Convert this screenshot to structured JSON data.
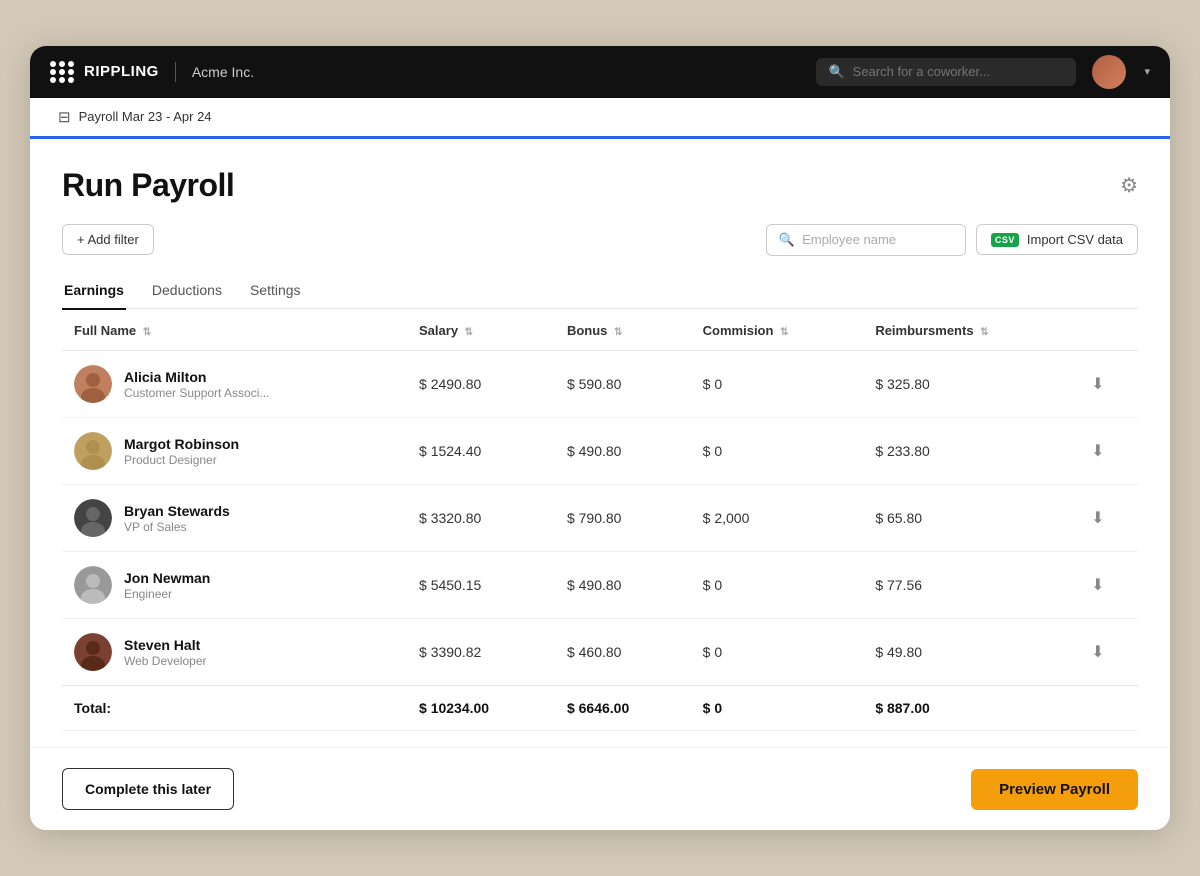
{
  "nav": {
    "logo_text": "RIPPLING",
    "company": "Acme Inc.",
    "search_placeholder": "Search for a coworker...",
    "chevron": "▾"
  },
  "breadcrumb": {
    "text": "Payroll Mar 23 - Apr 24"
  },
  "page": {
    "title": "Run Payroll"
  },
  "toolbar": {
    "add_filter": "+ Add filter",
    "employee_placeholder": "Employee name",
    "csv_badge": "CSV",
    "import_csv": "Import CSV data"
  },
  "tabs": [
    {
      "id": "earnings",
      "label": "Earnings",
      "active": true
    },
    {
      "id": "deductions",
      "label": "Deductions",
      "active": false
    },
    {
      "id": "settings",
      "label": "Settings",
      "active": false
    }
  ],
  "table": {
    "columns": [
      {
        "id": "name",
        "label": "Full Name"
      },
      {
        "id": "salary",
        "label": "Salary"
      },
      {
        "id": "bonus",
        "label": "Bonus"
      },
      {
        "id": "commission",
        "label": "Commision"
      },
      {
        "id": "reimbursements",
        "label": "Reimbursments"
      }
    ],
    "rows": [
      {
        "id": "alicia",
        "name": "Alicia Milton",
        "role": "Customer Support Associ...",
        "salary": "$ 2490.80",
        "bonus": "$ 590.80",
        "commission": "$ 0",
        "reimbursements": "$ 325.80",
        "avatar_color1": "#b07050",
        "avatar_color2": "#c89070"
      },
      {
        "id": "margot",
        "name": "Margot Robinson",
        "role": "Product Designer",
        "salary": "$ 1524.40",
        "bonus": "$ 490.80",
        "commission": "$ 0",
        "reimbursements": "$ 233.80",
        "avatar_color1": "#c0a060",
        "avatar_color2": "#d4b880"
      },
      {
        "id": "bryan",
        "name": "Bryan Stewards",
        "role": "VP of Sales",
        "salary": "$ 3320.80",
        "bonus": "$ 790.80",
        "commission": "$ 2,000",
        "reimbursements": "$ 65.80",
        "avatar_color1": "#333",
        "avatar_color2": "#555"
      },
      {
        "id": "jon",
        "name": "Jon Newman",
        "role": "Engineer",
        "salary": "$ 5450.15",
        "bonus": "$ 490.80",
        "commission": "$ 0",
        "reimbursements": "$ 77.56",
        "avatar_color1": "#888",
        "avatar_color2": "#aaa"
      },
      {
        "id": "steven",
        "name": "Steven Halt",
        "role": "Web Developer",
        "salary": "$ 3390.82",
        "bonus": "$ 460.80",
        "commission": "$ 0",
        "reimbursements": "$ 49.80",
        "avatar_color1": "#5a3020",
        "avatar_color2": "#7a5040"
      }
    ],
    "total": {
      "label": "Total:",
      "salary": "$ 10234.00",
      "bonus": "$ 6646.00",
      "commission": "$ 0",
      "reimbursements": "$ 887.00"
    }
  },
  "footer": {
    "complete_later": "Complete this later",
    "preview_payroll": "Preview Payroll"
  }
}
